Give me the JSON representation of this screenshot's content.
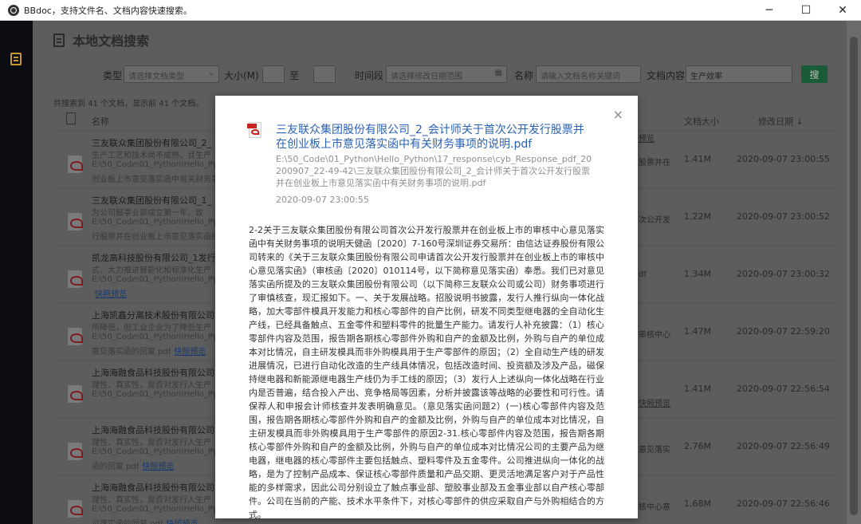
{
  "window": {
    "title": "BBdoc，支持文件名、文档内容快速搜索。",
    "min": "─",
    "max": "☐",
    "close": "✕"
  },
  "page": {
    "title": "本地文档搜索"
  },
  "filters": {
    "type_label": "类型",
    "type_placeholder": "请选择文档类型",
    "size_label": "大小(M)",
    "to": "至",
    "time_label": "时间段",
    "time_placeholder": "请选择修改日期范围",
    "name_label": "名称",
    "name_placeholder": "请输入文档名称关键词",
    "content_label": "文档内容",
    "content_value": "生产效率",
    "search_button": "搜"
  },
  "result_count": "共搜索到 41 个文档，显示前 41 个文档。",
  "table": {
    "col_name": "名称",
    "col_size": "文档大小",
    "col_date": "修改日期 ↓"
  },
  "rows": [
    {
      "title": "三友联众集团股份有限公司_2_",
      "l1": "生产工艺和技术尚不成熟，且生产",
      "l2": "E:\\50_Code\\01_Python\\Hello_Pyth",
      "l3": "创业板上市意见落实函中有关财务事",
      "link": "",
      "right1": "预览",
      "right2": "股票并在",
      "size": "1.41M",
      "date": "2020-09-07 23:00:55"
    },
    {
      "title": "三友联众集团股份有限公司_1_",
      "l1": "为公司鼓事业部成立第一年，致",
      "l2": "E:\\50_Code\\01_Python\\Hello_Pyth",
      "l3": "行股票并在创业板上市意见落实函的",
      "link": "",
      "right1": "",
      "right2": "次公开发",
      "size": "1.22M",
      "date": "2020-09-07 23:00:52"
    },
    {
      "title": "凯龙高科技股份有限公司_1发行",
      "l1": "式，大力推进智能化和标准化生产",
      "l2": "E:\\50_Code\\01_Python\\Hello_Pyth",
      "l3": "",
      "link": "快照预览",
      "right1": "",
      "right2": "df",
      "size": "1.34M",
      "date": "2020-09-07 23:00:32"
    },
    {
      "title": "上海凯鑫分离技术股份有限公司",
      "l1": "所降低，但工业企业为了降低生产",
      "l2": "E:\\50_Code\\01_Python\\Hello_Pyth",
      "l3": "意见落实函的回复.pdf",
      "link": "快照预览",
      "right1": "",
      "right2": "审核中心",
      "size": "1.47M",
      "date": "2020-09-07 22:59:20"
    },
    {
      "title": "上海海融食品科技股份有限公司",
      "l1": "理性、真实性，是否对发行人生产",
      "l2": "E:\\50_Code\\01_Python\\Hello_Pyth",
      "l3": "",
      "link": "",
      "right1": "快照预览",
      "right2": "",
      "size": "1.41M",
      "date": "2020-09-07 22:56:54"
    },
    {
      "title": "上海海融食品科技股份有限公司",
      "l1": "理性、真实性，是否对发行人生产",
      "l2": "E:\\50_Code\\01_Python\\Hello_Pyth",
      "l3": "函的回复.pdf",
      "link": "快照预览",
      "right1": "",
      "right2": "意见落实",
      "size": "2.76M",
      "date": "2020-09-07 22:56:49"
    },
    {
      "title": "上海海融食品科技股份有限公司",
      "l1": "理性、真实性，是否对发行人生产",
      "l2": "E:\\50_Code\\01_Python\\Hello_Pyth",
      "l3": "见落实函的回复.pdf",
      "link": "快照预览",
      "right1": "",
      "right2": "核中心意",
      "size": "1.68M",
      "date": "2020-09-07 22:56:46"
    }
  ],
  "modal": {
    "close": "×",
    "title": "三友联众集团股份有限公司_2_会计师关于首次公开发行股票并在创业板上市意见落实函中有关财务事项的说明.pdf",
    "path": "E:\\50_Code\\01_Python\\Hello_Python\\17_response\\cyb_Response_pdf_20200907_22-49-42\\三友联众集团股份有限公司_2_会计师关于首次公开发行股票并在创业板上市意见落实函中有关财务事项的说明.pdf",
    "date": "2020-09-07 23:00:55",
    "body": "2-2关于三友联众集团股份有限公司首次公开发行股票并在创业板上市的审核中心意见落实函中有关财务事项的说明天健函〔2020〕7-160号深圳证券交易所：由信达证券股份有限公司转来的《关于三友联众集团股份有限公司申请首次公开发行股票并在创业板上市的审核中心意见落实函》（审核函〔2020〕010114号，以下简称意见落实函）奉悉。我们已对意见落实函所提及的三友联众集团股份有限公司（以下简称三友联众公司或公司）财务事项进行了审慎核查，现汇报如下。一、关于发展战略。招股说明书披露，发行人推行纵向一体化战略，加大零部件模具开发能力和核心零部件的自产比例，研发不同类型继电器的全自动化生产线，已经具备触点、五金零件和塑料零件的批量生产能力。请发行人补充披露：（1）核心零部件内容及范围，报告期各期核心零部件外购和自产的金额及比例，外购与自产的单位成本对比情况，自主研发模具而非外购模具用于生产零部件的原因；（2）全自动生产线的研发进展情况，已进行自动化改造的生产线具体情况，包括改造时间、投资额及涉及产品，磁保持继电器和新能源继电器生产线仍为手工线的原因；（3）发行人上述纵向一体化战略在行业内是否普遍，结合投入产出、竞争格局等因素，分析并披露该等战略的必要性和可行性。请保荐人和申报会计师核查并发表明确意见。（意见落实函问题2）(一)核心零部件内容及范围，报告期各期核心零部件外购和自产的金额及比例，外购与自产的单位成本对比情况，自主研发模具而非外购模具用于生产零部件的原因2-31.核心零部件内容及范围，报告期各期核心零部件外购和自产的金额及比例，外购与自产的单位成本对比情况公司的主要产品为继电器，继电器的核心零部件主要包括触点、塑料零件及五金零件。公司推进纵向一体化的战略，是为了控制产品成本、保证核心零部件质量和产品交期、更灵活地满足客户对于产品性能的多样需求，因此公司分别设立了触点事业部、塑胶事业部及五金事业部以自产核心零部件。公司在当前的产能、技术水平条件下，对核心零部件的供应采取自产与外购相结合的方式。"
  }
}
